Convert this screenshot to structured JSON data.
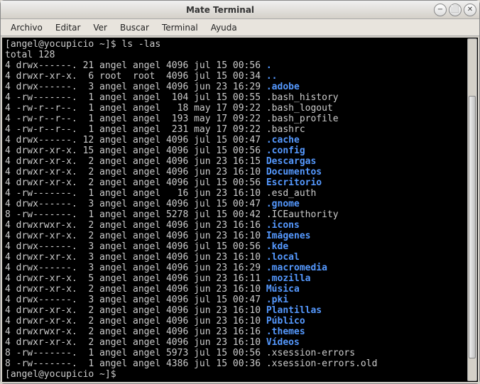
{
  "window": {
    "title": "Mate Terminal",
    "minimize": "−",
    "maximize": "⬜",
    "close": "✕"
  },
  "menubar": [
    "Archivo",
    "Editar",
    "Ver",
    "Buscar",
    "Terminal",
    "Ayuda"
  ],
  "terminal": {
    "prompt1": "[angel@yocupicio ~]$ ",
    "command": "ls -las",
    "total_line": "total 128",
    "prompt2": "[angel@yocupicio ~]$ ",
    "rows": [
      {
        "blocks": "4",
        "perm": "drwx------.",
        "links": "21",
        "owner": "angel",
        "group": "angel",
        "size": "4096",
        "date": "jul 15 00:56",
        "name": ".",
        "type": "dir"
      },
      {
        "blocks": "4",
        "perm": "drwxr-xr-x.",
        "links": "6",
        "owner": "root",
        "group": "root",
        "size": "4096",
        "date": "jul 15 00:34",
        "name": "..",
        "type": "dir"
      },
      {
        "blocks": "4",
        "perm": "drwx------.",
        "links": "3",
        "owner": "angel",
        "group": "angel",
        "size": "4096",
        "date": "jun 23 16:29",
        "name": ".adobe",
        "type": "dir"
      },
      {
        "blocks": "4",
        "perm": "-rw-------.",
        "links": "1",
        "owner": "angel",
        "group": "angel",
        "size": "104",
        "date": "jul 15 00:55",
        "name": ".bash_history",
        "type": "file"
      },
      {
        "blocks": "4",
        "perm": "-rw-r--r--.",
        "links": "1",
        "owner": "angel",
        "group": "angel",
        "size": "18",
        "date": "may 17 09:22",
        "name": ".bash_logout",
        "type": "file"
      },
      {
        "blocks": "4",
        "perm": "-rw-r--r--.",
        "links": "1",
        "owner": "angel",
        "group": "angel",
        "size": "193",
        "date": "may 17 09:22",
        "name": ".bash_profile",
        "type": "file"
      },
      {
        "blocks": "4",
        "perm": "-rw-r--r--.",
        "links": "1",
        "owner": "angel",
        "group": "angel",
        "size": "231",
        "date": "may 17 09:22",
        "name": ".bashrc",
        "type": "file"
      },
      {
        "blocks": "4",
        "perm": "drwx------.",
        "links": "12",
        "owner": "angel",
        "group": "angel",
        "size": "4096",
        "date": "jul 15 00:47",
        "name": ".cache",
        "type": "dir"
      },
      {
        "blocks": "4",
        "perm": "drwxr-xr-x.",
        "links": "15",
        "owner": "angel",
        "group": "angel",
        "size": "4096",
        "date": "jul 15 00:56",
        "name": ".config",
        "type": "dir"
      },
      {
        "blocks": "4",
        "perm": "drwxr-xr-x.",
        "links": "2",
        "owner": "angel",
        "group": "angel",
        "size": "4096",
        "date": "jun 23 16:15",
        "name": "Descargas",
        "type": "dir"
      },
      {
        "blocks": "4",
        "perm": "drwxr-xr-x.",
        "links": "2",
        "owner": "angel",
        "group": "angel",
        "size": "4096",
        "date": "jun 23 16:10",
        "name": "Documentos",
        "type": "dir"
      },
      {
        "blocks": "4",
        "perm": "drwxr-xr-x.",
        "links": "2",
        "owner": "angel",
        "group": "angel",
        "size": "4096",
        "date": "jul 15 00:56",
        "name": "Escritorio",
        "type": "dir"
      },
      {
        "blocks": "4",
        "perm": "-rw-------.",
        "links": "1",
        "owner": "angel",
        "group": "angel",
        "size": "16",
        "date": "jun 23 16:10",
        "name": ".esd_auth",
        "type": "file"
      },
      {
        "blocks": "4",
        "perm": "drwx------.",
        "links": "3",
        "owner": "angel",
        "group": "angel",
        "size": "4096",
        "date": "jul 15 00:47",
        "name": ".gnome",
        "type": "dir"
      },
      {
        "blocks": "8",
        "perm": "-rw-------.",
        "links": "1",
        "owner": "angel",
        "group": "angel",
        "size": "5278",
        "date": "jul 15 00:42",
        "name": ".ICEauthority",
        "type": "file"
      },
      {
        "blocks": "4",
        "perm": "drwxrwxr-x.",
        "links": "2",
        "owner": "angel",
        "group": "angel",
        "size": "4096",
        "date": "jun 23 16:16",
        "name": ".icons",
        "type": "dir"
      },
      {
        "blocks": "4",
        "perm": "drwxr-xr-x.",
        "links": "2",
        "owner": "angel",
        "group": "angel",
        "size": "4096",
        "date": "jun 23 16:10",
        "name": "Imágenes",
        "type": "dir"
      },
      {
        "blocks": "4",
        "perm": "drwx------.",
        "links": "3",
        "owner": "angel",
        "group": "angel",
        "size": "4096",
        "date": "jul 15 00:56",
        "name": ".kde",
        "type": "dir"
      },
      {
        "blocks": "4",
        "perm": "drwxr-xr-x.",
        "links": "3",
        "owner": "angel",
        "group": "angel",
        "size": "4096",
        "date": "jun 23 16:10",
        "name": ".local",
        "type": "dir"
      },
      {
        "blocks": "4",
        "perm": "drwx------.",
        "links": "3",
        "owner": "angel",
        "group": "angel",
        "size": "4096",
        "date": "jun 23 16:29",
        "name": ".macromedia",
        "type": "dir"
      },
      {
        "blocks": "4",
        "perm": "drwxr-xr-x.",
        "links": "5",
        "owner": "angel",
        "group": "angel",
        "size": "4096",
        "date": "jun 23 16:11",
        "name": ".mozilla",
        "type": "dir"
      },
      {
        "blocks": "4",
        "perm": "drwxr-xr-x.",
        "links": "2",
        "owner": "angel",
        "group": "angel",
        "size": "4096",
        "date": "jun 23 16:10",
        "name": "Música",
        "type": "dir"
      },
      {
        "blocks": "4",
        "perm": "drwx------.",
        "links": "3",
        "owner": "angel",
        "group": "angel",
        "size": "4096",
        "date": "jul 15 00:47",
        "name": ".pki",
        "type": "dir"
      },
      {
        "blocks": "4",
        "perm": "drwxr-xr-x.",
        "links": "2",
        "owner": "angel",
        "group": "angel",
        "size": "4096",
        "date": "jun 23 16:10",
        "name": "Plantillas",
        "type": "dir"
      },
      {
        "blocks": "4",
        "perm": "drwxr-xr-x.",
        "links": "2",
        "owner": "angel",
        "group": "angel",
        "size": "4096",
        "date": "jun 23 16:10",
        "name": "Público",
        "type": "dir"
      },
      {
        "blocks": "4",
        "perm": "drwxrwxr-x.",
        "links": "2",
        "owner": "angel",
        "group": "angel",
        "size": "4096",
        "date": "jun 23 16:16",
        "name": ".themes",
        "type": "dir"
      },
      {
        "blocks": "4",
        "perm": "drwxr-xr-x.",
        "links": "2",
        "owner": "angel",
        "group": "angel",
        "size": "4096",
        "date": "jun 23 16:10",
        "name": "Vídeos",
        "type": "dir"
      },
      {
        "blocks": "8",
        "perm": "-rw-------.",
        "links": "1",
        "owner": "angel",
        "group": "angel",
        "size": "5973",
        "date": "jul 15 00:56",
        "name": ".xsession-errors",
        "type": "file"
      },
      {
        "blocks": "8",
        "perm": "-rw-------.",
        "links": "1",
        "owner": "angel",
        "group": "angel",
        "size": "4386",
        "date": "jul 15 00:36",
        "name": ".xsession-errors.old",
        "type": "file"
      }
    ]
  }
}
